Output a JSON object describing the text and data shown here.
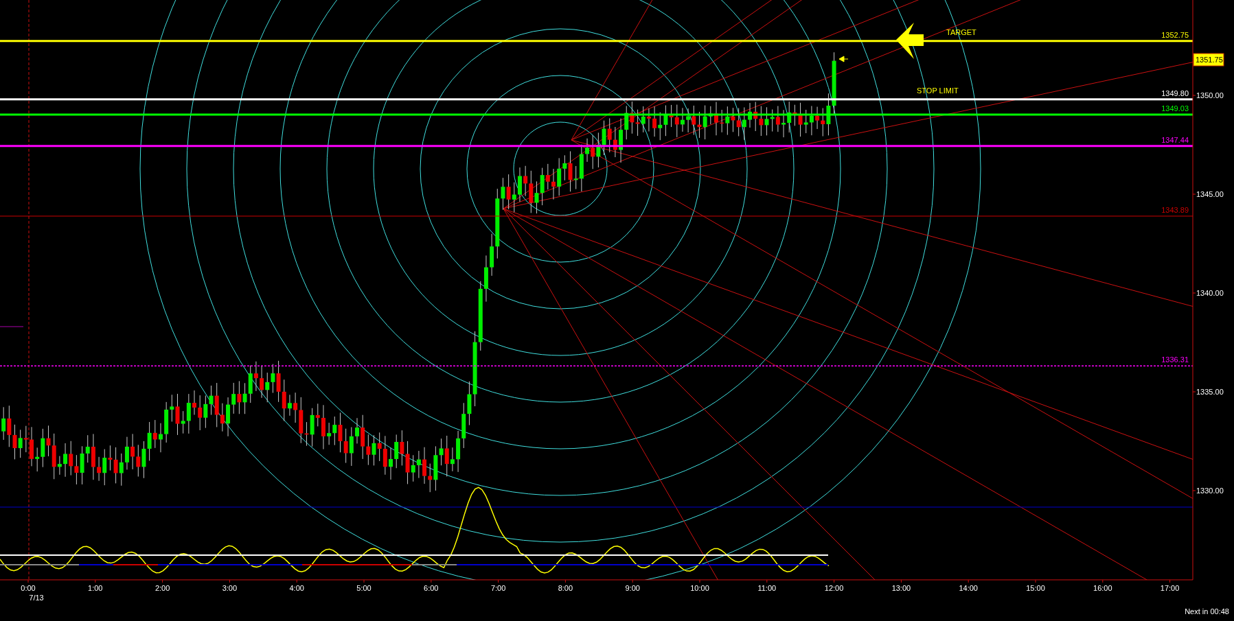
{
  "price_axis": {
    "ticks": [
      "1350.00",
      "1345.00",
      "1340.00",
      "1335.00",
      "1330.00"
    ]
  },
  "current_price": "1351.75",
  "levels": [
    {
      "kind": "thick",
      "label": "TARGET",
      "value": "1352.75",
      "color": "#ffff00"
    },
    {
      "kind": "thick",
      "label": "STOP LIMIT",
      "value": "1349.80",
      "color": "#ffffff"
    },
    {
      "kind": "thick",
      "value": "1349.03",
      "color": "#00ff00"
    },
    {
      "kind": "thick",
      "value": "1347.44",
      "color": "#ff00ff"
    },
    {
      "kind": "thin",
      "value": "1343.89",
      "color": "#cc0000"
    },
    {
      "kind": "dashed",
      "value": "1336.31",
      "color": "#ff00ff"
    }
  ],
  "time_axis": {
    "ticks": [
      "0:00",
      "1:00",
      "2:00",
      "3:00",
      "4:00",
      "5:00",
      "6:00",
      "7:00",
      "8:00",
      "9:00",
      "10:00",
      "11:00",
      "12:00",
      "13:00",
      "14:00",
      "15:00",
      "16:00",
      "17:00"
    ],
    "date": "7/13"
  },
  "status": "Next in 00:48"
}
